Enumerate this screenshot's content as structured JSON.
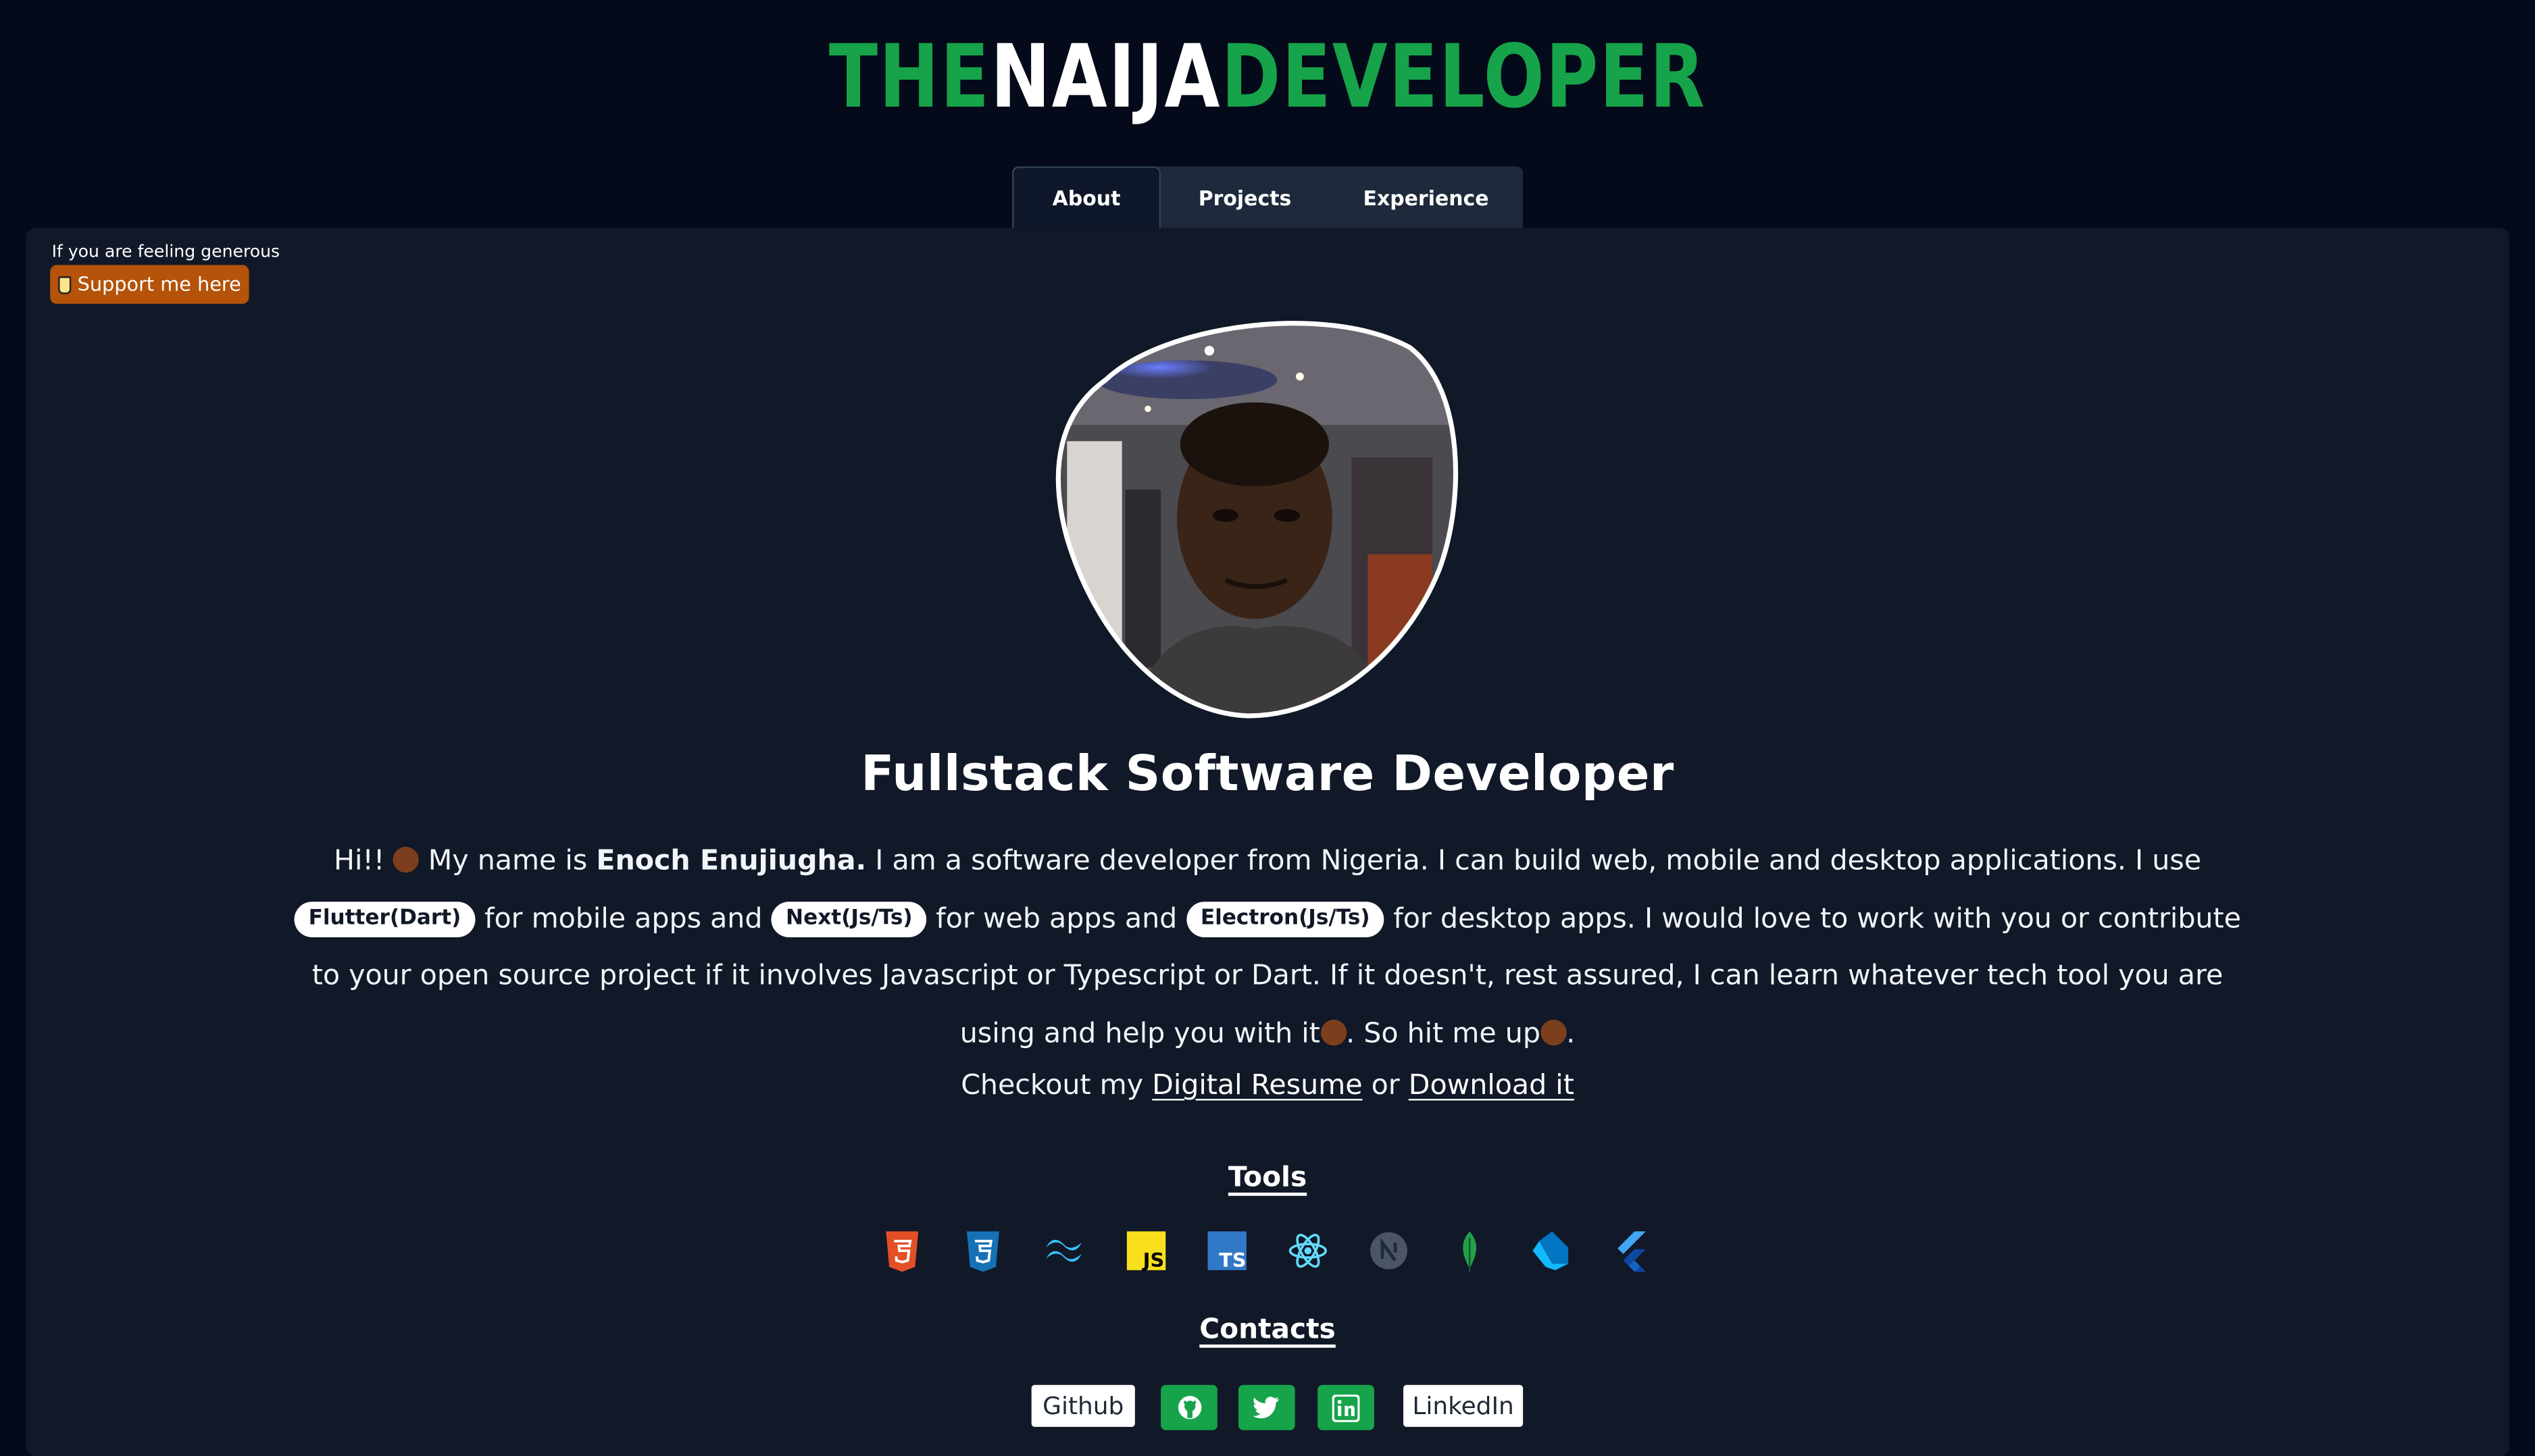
{
  "logo": {
    "part1": "THE",
    "part2": "NAIJA",
    "part3": "DEVELOPER"
  },
  "tabs": [
    {
      "label": "About",
      "active": true
    },
    {
      "label": "Projects",
      "active": false
    },
    {
      "label": "Experience",
      "active": false
    }
  ],
  "support": {
    "caption": "If you are feeling generous",
    "button": "Support me here"
  },
  "headline": "Fullstack Software Developer",
  "bio": {
    "greeting": "Hi!!",
    "intro": " My name is ",
    "name": "Enoch Enujiugha.",
    "s1": " I am a software developer from Nigeria. I can build web, mobile and desktop applications. I use ",
    "chip_mobile": "Flutter(Dart)",
    "s2": " for mobile apps and ",
    "chip_web": "Next(Js/Ts)",
    "s3": " for web apps and ",
    "chip_desktop": "Electron(Js/Ts)",
    "s4": " for desktop apps. I would love to work with you or contribute to your open source project if it involves Javascript or Typescript or Dart. If it doesn't, rest assured, I can learn whatever tech tool you are using and help you with it",
    "s5": ". So hit me up",
    "s6": "."
  },
  "resume": {
    "prefix": "Checkout my ",
    "digital": "Digital Resume",
    "middle": " or ",
    "download": "Download it"
  },
  "tools": {
    "title": "Tools",
    "icons": [
      "html5-icon",
      "css3-icon",
      "tailwind-icon",
      "javascript-icon",
      "typescript-icon",
      "react-icon",
      "nextjs-icon",
      "mongodb-icon",
      "dart-icon",
      "flutter-icon"
    ]
  },
  "contacts": {
    "title": "Contacts",
    "github_label": "Github",
    "linkedin_label": "LinkedIn"
  },
  "colors": {
    "background": "#040a1a",
    "panel": "#111827",
    "accent": "#16a34a",
    "support": "#b45309"
  }
}
